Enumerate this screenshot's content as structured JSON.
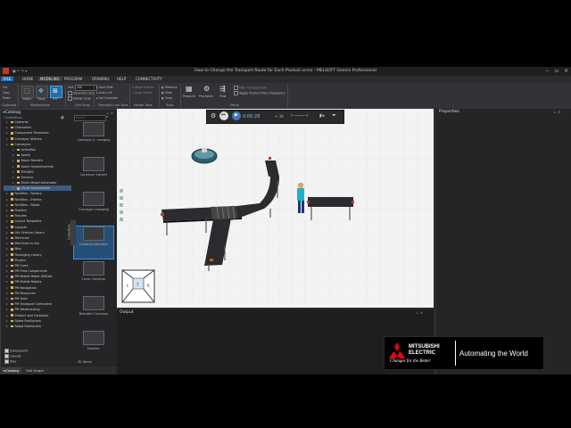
{
  "window": {
    "title": "How to Change the Transport Route for Each Product.vcmx - MELSOFT Gemini Professional"
  },
  "menu": {
    "file": "FILE",
    "tabs": [
      "HOME",
      "MODELING",
      "PROGRAM",
      "DRAWING",
      "HELP",
      "CONNECTIVITY"
    ],
    "active_tab": "MODELING"
  },
  "ribbon": {
    "clipboard": {
      "items": [
        "Cut",
        "Copy",
        "Paste"
      ],
      "group": "Clipboard"
    },
    "manipulation": {
      "buttons": [
        "Select",
        "Move",
        "PnP"
      ],
      "group": "Manipulation"
    },
    "grid_snap": {
      "size_label": "Size",
      "size_value": "100",
      "options": [
        "Automatic Size",
        "Always Snap"
      ],
      "group": "Grid Snap"
    },
    "transport": {
      "options": [
        "Start Shift",
        "Auto Link",
        "Set Controller"
      ],
      "group": "Transport Link Tools"
    },
    "helper": {
      "options": [
        "Show Frames",
        "Snap Frame"
      ],
      "group": "Helper Tools"
    },
    "tools": {
      "options": [
        "Measure",
        "Align",
        "Snap"
      ],
      "group": "Tools"
    },
    "editor": {
      "buttons": [
        "Products",
        "Processes",
        "Flow"
      ],
      "options": [
        "Hide Transport Link",
        "Toggle Product Filter Diagnostics"
      ],
      "group": "Editor"
    }
  },
  "ecatalog": {
    "title": "eCatalog",
    "section": "Collections",
    "search_placeholder": "Search",
    "tree": [
      {
        "label": "Cameras",
        "level": 1
      },
      {
        "label": "Characters",
        "level": 1
      },
      {
        "label": "Component Templates",
        "level": 1
      },
      {
        "label": "Conveyor Utilities",
        "level": 1
      },
      {
        "label": "Conveyors",
        "level": 1
      },
      {
        "label": "Activefloc",
        "level": 2
      },
      {
        "label": "Apollo",
        "level": 2
      },
      {
        "label": "Bosch Rexroth",
        "level": 2
      },
      {
        "label": "Bosch Systemtechnik",
        "level": 2
      },
      {
        "label": "MYSARS",
        "level": 2
      },
      {
        "label": "Omarsu",
        "level": 2
      },
      {
        "label": "Rhein-Model Automatio",
        "level": 2
      },
      {
        "label": "Visual Components",
        "level": 2,
        "selected": true
      },
      {
        "label": "Facilities - Factory",
        "level": 1
      },
      {
        "label": "Facilities - Interior",
        "level": 1
      },
      {
        "label": "Facilities - Robot",
        "level": 1
      },
      {
        "label": "Feeders",
        "level": 1
      },
      {
        "label": "Fixtures",
        "level": 1
      },
      {
        "label": "Layout Templates",
        "level": 1
      },
      {
        "label": "Layouts",
        "level": 1
      },
      {
        "label": "Life Science Library",
        "level": 1
      },
      {
        "label": "Machines",
        "level": 1
      },
      {
        "label": "Machines In-line",
        "level": 1
      },
      {
        "label": "Misc",
        "level": 1
      },
      {
        "label": "Packaging Library",
        "level": 1
      },
      {
        "label": "Physics",
        "level": 1
      },
      {
        "label": "PM Carts",
        "level": 1
      },
      {
        "label": "PM Flow Components",
        "level": 1
      },
      {
        "label": "PM Mobile Robot Utilities",
        "level": 1
      },
      {
        "label": "PM Mobile Robots",
        "level": 1
      },
      {
        "label": "PM Navigation",
        "level": 1
      },
      {
        "label": "PM Resources",
        "level": 1
      },
      {
        "label": "PM Tools",
        "level": 1
      },
      {
        "label": "PM Transport Controllers",
        "level": 1
      },
      {
        "label": "PM Warehousing",
        "level": 1
      },
      {
        "label": "Product and Container",
        "level": 1
      },
      {
        "label": "Robot Positioners",
        "level": 1
      },
      {
        "label": "Robot Positioners",
        "level": 1
      }
    ],
    "filters": [
      "Components",
      "Layouts",
      "Files"
    ],
    "thumbnails": [
      {
        "label": "Conveyor II - merging"
      },
      {
        "label": "Conveyor Y-divert"
      },
      {
        "label": "Conveyor I-merging"
      },
      {
        "label": "Crossing Conveyor",
        "selected": true
      },
      {
        "label": "Curve Conveyor"
      },
      {
        "label": "Deduster Conveyor"
      },
      {
        "label": "Diverter"
      }
    ],
    "items_count": "35 Items",
    "side_tab": "Collections"
  },
  "viewport": {
    "sim_time": "0:00:28",
    "speed": "+ 38"
  },
  "output": {
    "title": "Output"
  },
  "properties": {
    "title": "Properties"
  },
  "bottom_tabs": [
    {
      "label": "eCatalog",
      "active": true
    },
    {
      "label": "Cell Graph",
      "active": false
    }
  ],
  "logo": {
    "brand_line1": "MITSUBISHI",
    "brand_line2": "ELECTRIC",
    "slogan": "Changes for the Better",
    "tagline": "Automating the World"
  },
  "colors": {
    "accent": "#1a6fc1",
    "conveyor": "#2b2b2e",
    "mitsubishi_red": "#e60012"
  }
}
